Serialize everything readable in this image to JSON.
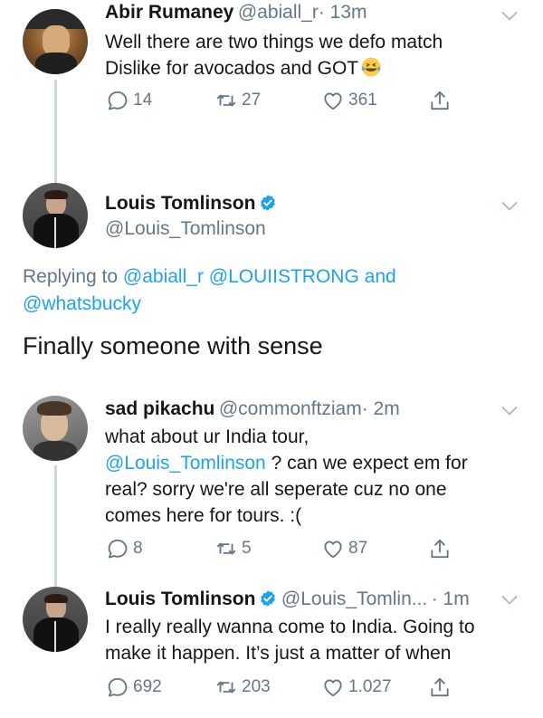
{
  "colors": {
    "link": "#1da1f2",
    "muted": "#657786",
    "text": "#14171a",
    "verified": "#1da1f2",
    "thread_line": "#ccd6dd"
  },
  "tweet1": {
    "name": "Abir Rumaney",
    "handle": "@abiall_r",
    "time": "· 13m",
    "line1": "Well there are two things we defo match",
    "line2": "Dislike for avocados and GOT",
    "emoji": "tears-of-joy-emoji",
    "replies": "14",
    "retweets": "27",
    "likes": "361"
  },
  "main_tweet": {
    "name": "Louis Tomlinson",
    "handle": "@Louis_Tomlinson",
    "replying_prefix": "Replying to",
    "mention1": "@abiall_r",
    "mention2": "@LOUIISTRONG",
    "and_text": "and",
    "mention3": "@whatsbucky",
    "text": "Finally someone with sense"
  },
  "tweet3": {
    "name": "sad pikachu",
    "handle": "@commonftziam",
    "time": "· 2m",
    "line1": "what about ur India tour,",
    "mention": "@Louis_Tomlinson",
    "line2_rest": " ? can we expect em for",
    "line3": "real? sorry we're all seperate cuz no one",
    "line4": "comes here for tours. :(",
    "replies": "8",
    "retweets": "5",
    "likes": "87"
  },
  "tweet4": {
    "name": "Louis Tomlinson",
    "handle": "@Louis_Tomlin...",
    "time": "· 1m",
    "line1": "I really really wanna come to India. Going to",
    "line2": "make it happen. It’s just a matter of when",
    "replies": "692",
    "retweets": "203",
    "likes": "1.027"
  }
}
